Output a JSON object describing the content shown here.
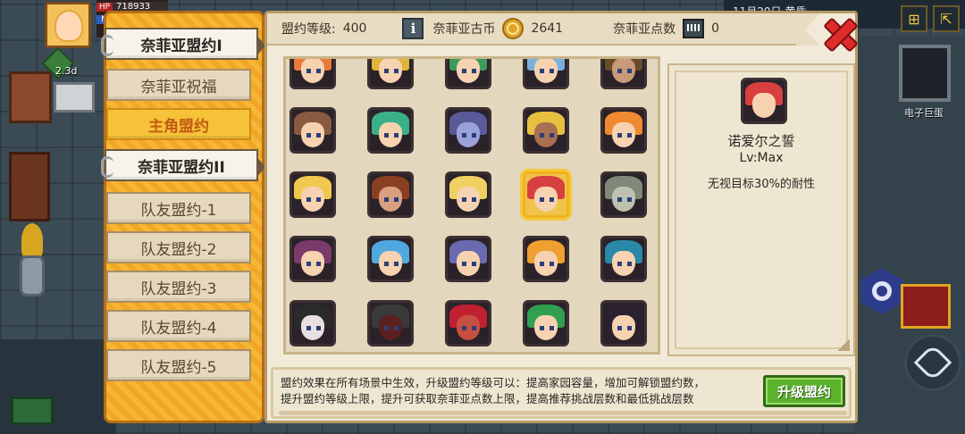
{
  "hud": {
    "hp_tag": "HP",
    "hp_value": "718933",
    "mp_tag": "M",
    "time_label": "2.3d"
  },
  "world": {
    "tv_label": "电子巨蛋",
    "clock_text": "11月20日 黄昏"
  },
  "tabs": [
    {
      "label": "奈菲亚盟约I",
      "state": "active"
    },
    {
      "label": "奈菲亚祝福",
      "state": "normal"
    },
    {
      "label": "主角盟约",
      "state": "gold"
    },
    {
      "label": "奈菲亚盟约II",
      "state": "active"
    },
    {
      "label": "队友盟约-1",
      "state": "normal"
    },
    {
      "label": "队友盟约-2",
      "state": "normal"
    },
    {
      "label": "队友盟约-3",
      "state": "normal"
    },
    {
      "label": "队友盟约-4",
      "state": "normal"
    },
    {
      "label": "队友盟约-5",
      "state": "normal"
    }
  ],
  "topbar": {
    "level_label": "盟约等级:",
    "level_value": "400",
    "coin_label": "奈菲亚古币",
    "coin_value": "2641",
    "points_label": "奈菲亚点数",
    "points_value": "0"
  },
  "portraits": [
    {
      "hair": "#e87a3a",
      "skin": "#f6d2b0"
    },
    {
      "hair": "#e0b33a",
      "skin": "#f6d2b0"
    },
    {
      "hair": "#3c9a5a",
      "skin": "#f6d2b0"
    },
    {
      "hair": "#7ab0e0",
      "skin": "#f6d2b0"
    },
    {
      "hair": "#6a4a2a",
      "skin": "#c89a78"
    },
    {
      "hair": "#8a5a40",
      "skin": "#f6d2b0"
    },
    {
      "hair": "#3ab08a",
      "skin": "#f6d2b0"
    },
    {
      "hair": "#5a5a9a",
      "skin": "#9aa0d8"
    },
    {
      "hair": "#e8c040",
      "skin": "#a87050"
    },
    {
      "hair": "#f08a30",
      "skin": "#f6d2b0"
    },
    {
      "hair": "#f0c850",
      "skin": "#f6d2b0"
    },
    {
      "hair": "#8a4020",
      "skin": "#d8a080"
    },
    {
      "hair": "#f0d060",
      "skin": "#f6d2b0"
    },
    {
      "hair": "#d84040",
      "skin": "#f6d2b0",
      "selected": true
    },
    {
      "hair": "#808878",
      "skin": "#c0c0b0"
    },
    {
      "hair": "#7a3a6a",
      "skin": "#f6d2b0"
    },
    {
      "hair": "#50a8e0",
      "skin": "#f6d2b0"
    },
    {
      "hair": "#6a6ab0",
      "skin": "#f6d2b0"
    },
    {
      "hair": "#f0a030",
      "skin": "#f6d2b0"
    },
    {
      "hair": "#2a88a8",
      "skin": "#f6d2b0"
    },
    {
      "hair": "#2a2a2a",
      "skin": "#e8e0e0"
    },
    {
      "hair": "#3a3a3a",
      "skin": "#5a2020"
    },
    {
      "hair": "#c02030",
      "skin": "#c85040"
    },
    {
      "hair": "#30a050",
      "skin": "#f6d2b0"
    },
    {
      "hair": "#2a2030",
      "skin": "#f6d2b0"
    }
  ],
  "detail": {
    "name": "诺爱尔之誓",
    "level": "Lv:Max",
    "effect": "无视目标30%的耐性",
    "portrait_hair": "#d84040"
  },
  "bottom": {
    "description_line1": "盟约效果在所有场景中生效，升级盟约等级可以：提高家园容量，增加可解锁盟约数，",
    "description_line2": "提升盟约等级上限，提升可获取奈菲亚点数上限，提高推荐挑战层数和最低挑战层数",
    "upgrade_label": "升级盟约"
  },
  "colors": {
    "accent_gold": "#f5c238",
    "upgrade_green": "#5bb22c",
    "close_red": "#e02b2b"
  }
}
